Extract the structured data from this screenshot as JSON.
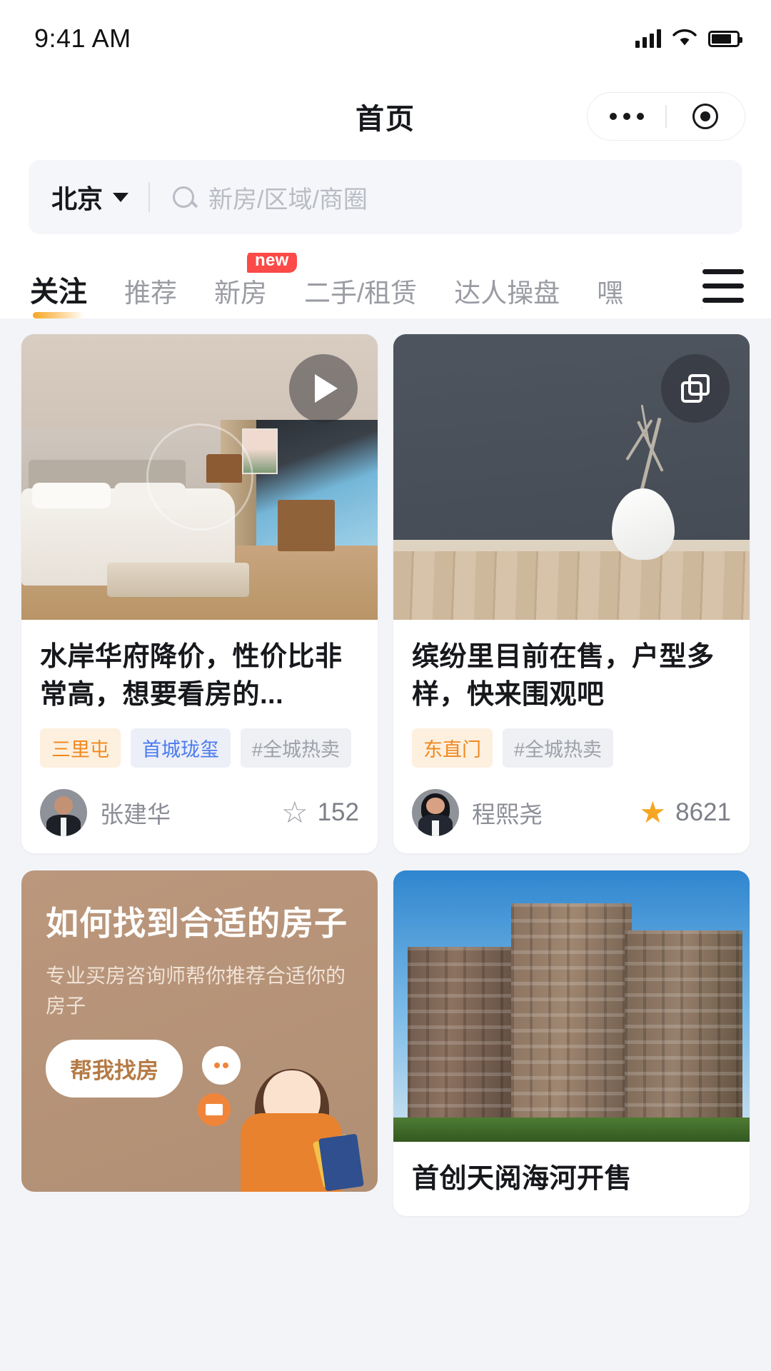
{
  "status_bar": {
    "time": "9:41 AM",
    "signal_icon": "signal-bars-icon",
    "wifi_icon": "wifi-icon",
    "battery_icon": "battery-icon"
  },
  "header": {
    "title": "首页",
    "more_icon": "more-dots-icon",
    "capsule_icon": "target-circle-icon"
  },
  "search": {
    "city": "北京",
    "caret_icon": "chevron-down-icon",
    "search_icon": "search-icon",
    "placeholder": "新房/区域/商圈"
  },
  "tabs": {
    "items": [
      {
        "label": "关注",
        "active": true,
        "badge": ""
      },
      {
        "label": "推荐",
        "active": false,
        "badge": ""
      },
      {
        "label": "新房",
        "active": false,
        "badge": "new"
      },
      {
        "label": "二手/租赁",
        "active": false,
        "badge": ""
      },
      {
        "label": "达人操盘",
        "active": false,
        "badge": ""
      },
      {
        "label": "嘿",
        "active": false,
        "badge": ""
      }
    ],
    "menu_icon": "hamburger-menu-icon"
  },
  "feed": {
    "cards": [
      {
        "id": "card-bedroom",
        "media_badge": "play-icon",
        "title": "水岸华府降价，性价比非常高，想要看房的...",
        "tags": [
          {
            "text": "三里屯",
            "style": "orange"
          },
          {
            "text": "首城珑玺",
            "style": "blue"
          },
          {
            "text": "#全城热卖",
            "style": "grey"
          }
        ],
        "author": "张建华",
        "avatar": "male-agent-avatar",
        "like_icon": "star-outline-icon",
        "likes": "152"
      },
      {
        "id": "card-vase",
        "media_badge": "image-stack-icon",
        "title": "缤纷里目前在售，户型多样，快来围观吧",
        "tags": [
          {
            "text": "东直门",
            "style": "orange"
          },
          {
            "text": "#全城热卖",
            "style": "grey"
          }
        ],
        "author": "程熙尧",
        "avatar": "female-agent-avatar",
        "like_icon": "star-filled-icon",
        "likes": "8621"
      },
      {
        "id": "card-promo",
        "title": "如何找到合适的房子",
        "subtitle": "专业买房咨询师帮你推荐合适你的房子",
        "button": "帮我找房"
      },
      {
        "id": "card-building",
        "title": "首创天阅海河开售"
      }
    ]
  },
  "colors": {
    "accent_orange": "#f5a623",
    "badge_red": "#fb4a47",
    "tag_blue": "#4b7bed",
    "promo_brown": "#b08f74",
    "text_primary": "#16181c",
    "text_muted": "#8b8e96"
  }
}
